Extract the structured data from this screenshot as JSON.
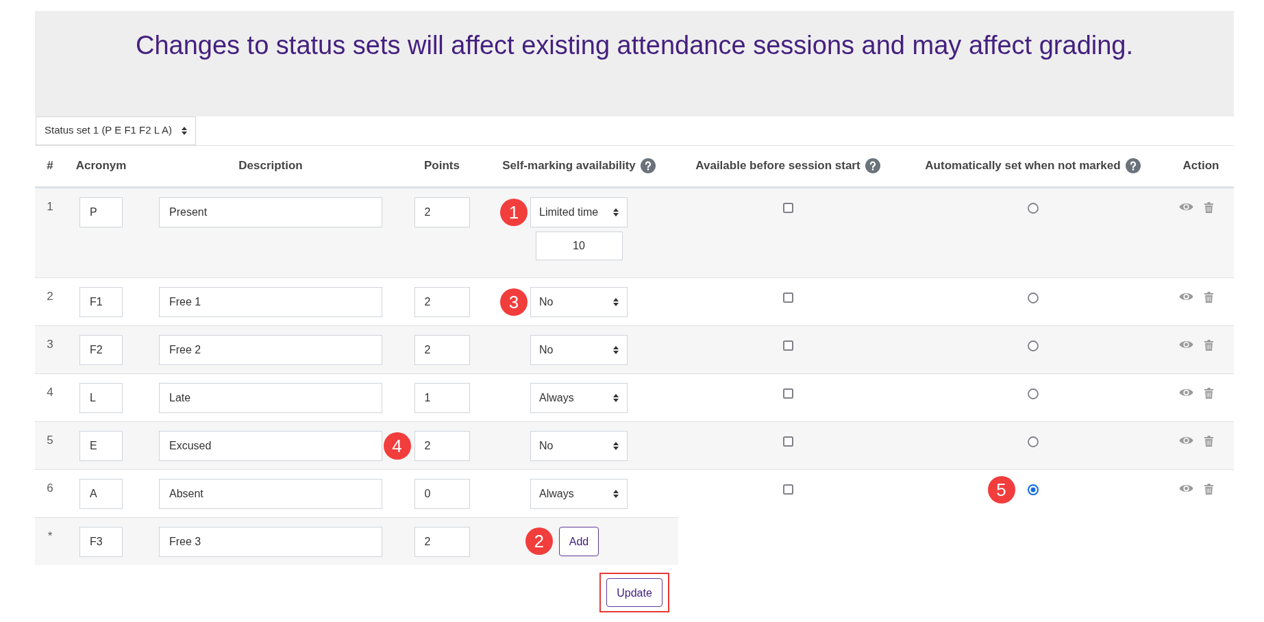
{
  "notice": {
    "text": "Changes to status sets will affect existing attendance sessions and may affect grading."
  },
  "status_set_select": {
    "value": "Status set 1 (P E F1 F2 L A)"
  },
  "table": {
    "columns": [
      {
        "label": "#",
        "help": false
      },
      {
        "label": "Acronym",
        "help": false
      },
      {
        "label": "Description",
        "help": false
      },
      {
        "label": "Points",
        "help": false
      },
      {
        "label": "Self-marking availability",
        "help": true
      },
      {
        "label": "Available before session start",
        "help": true
      },
      {
        "label": "Automatically set when not marked",
        "help": true
      },
      {
        "label": "Action",
        "help": false
      }
    ],
    "rows": [
      {
        "number": "1",
        "acronym": "P",
        "description": "Present",
        "points": "2",
        "self_marking": "Limited time",
        "time_limit": "10",
        "available_before_start": {
          "checked": false
        },
        "auto_set": {
          "selected": false
        },
        "self_marking_callout": "1"
      },
      {
        "number": "2",
        "acronym": "F1",
        "description": "Free 1",
        "points": "2",
        "self_marking": "No",
        "available_before_start": {
          "checked": false
        },
        "auto_set": {
          "selected": false
        },
        "self_marking_callout": "3"
      },
      {
        "number": "3",
        "acronym": "F2",
        "description": "Free 2",
        "points": "2",
        "self_marking": "No",
        "available_before_start": {
          "checked": false
        },
        "auto_set": {
          "selected": false
        }
      },
      {
        "number": "4",
        "acronym": "L",
        "description": "Late",
        "points": "1",
        "self_marking": "Always",
        "available_before_start": {
          "checked": false
        },
        "auto_set": {
          "selected": false
        }
      },
      {
        "number": "5",
        "acronym": "E",
        "description": "Excused",
        "points": "2",
        "self_marking": "No",
        "available_before_start": {
          "checked": false
        },
        "auto_set": {
          "selected": false
        },
        "points_callout": "4"
      },
      {
        "number": "6",
        "acronym": "A",
        "description": "Absent",
        "points": "0",
        "self_marking": "Always",
        "available_before_start": {
          "checked": false
        },
        "auto_set": {
          "selected": true
        },
        "auto_set_callout": "5"
      }
    ],
    "new_row": {
      "number": "*",
      "acronym": "F3",
      "description": "Free 3",
      "points": "2",
      "button": "Add",
      "button_callout": "2"
    }
  },
  "update_button": {
    "label": "Update",
    "highlighted": true
  }
}
